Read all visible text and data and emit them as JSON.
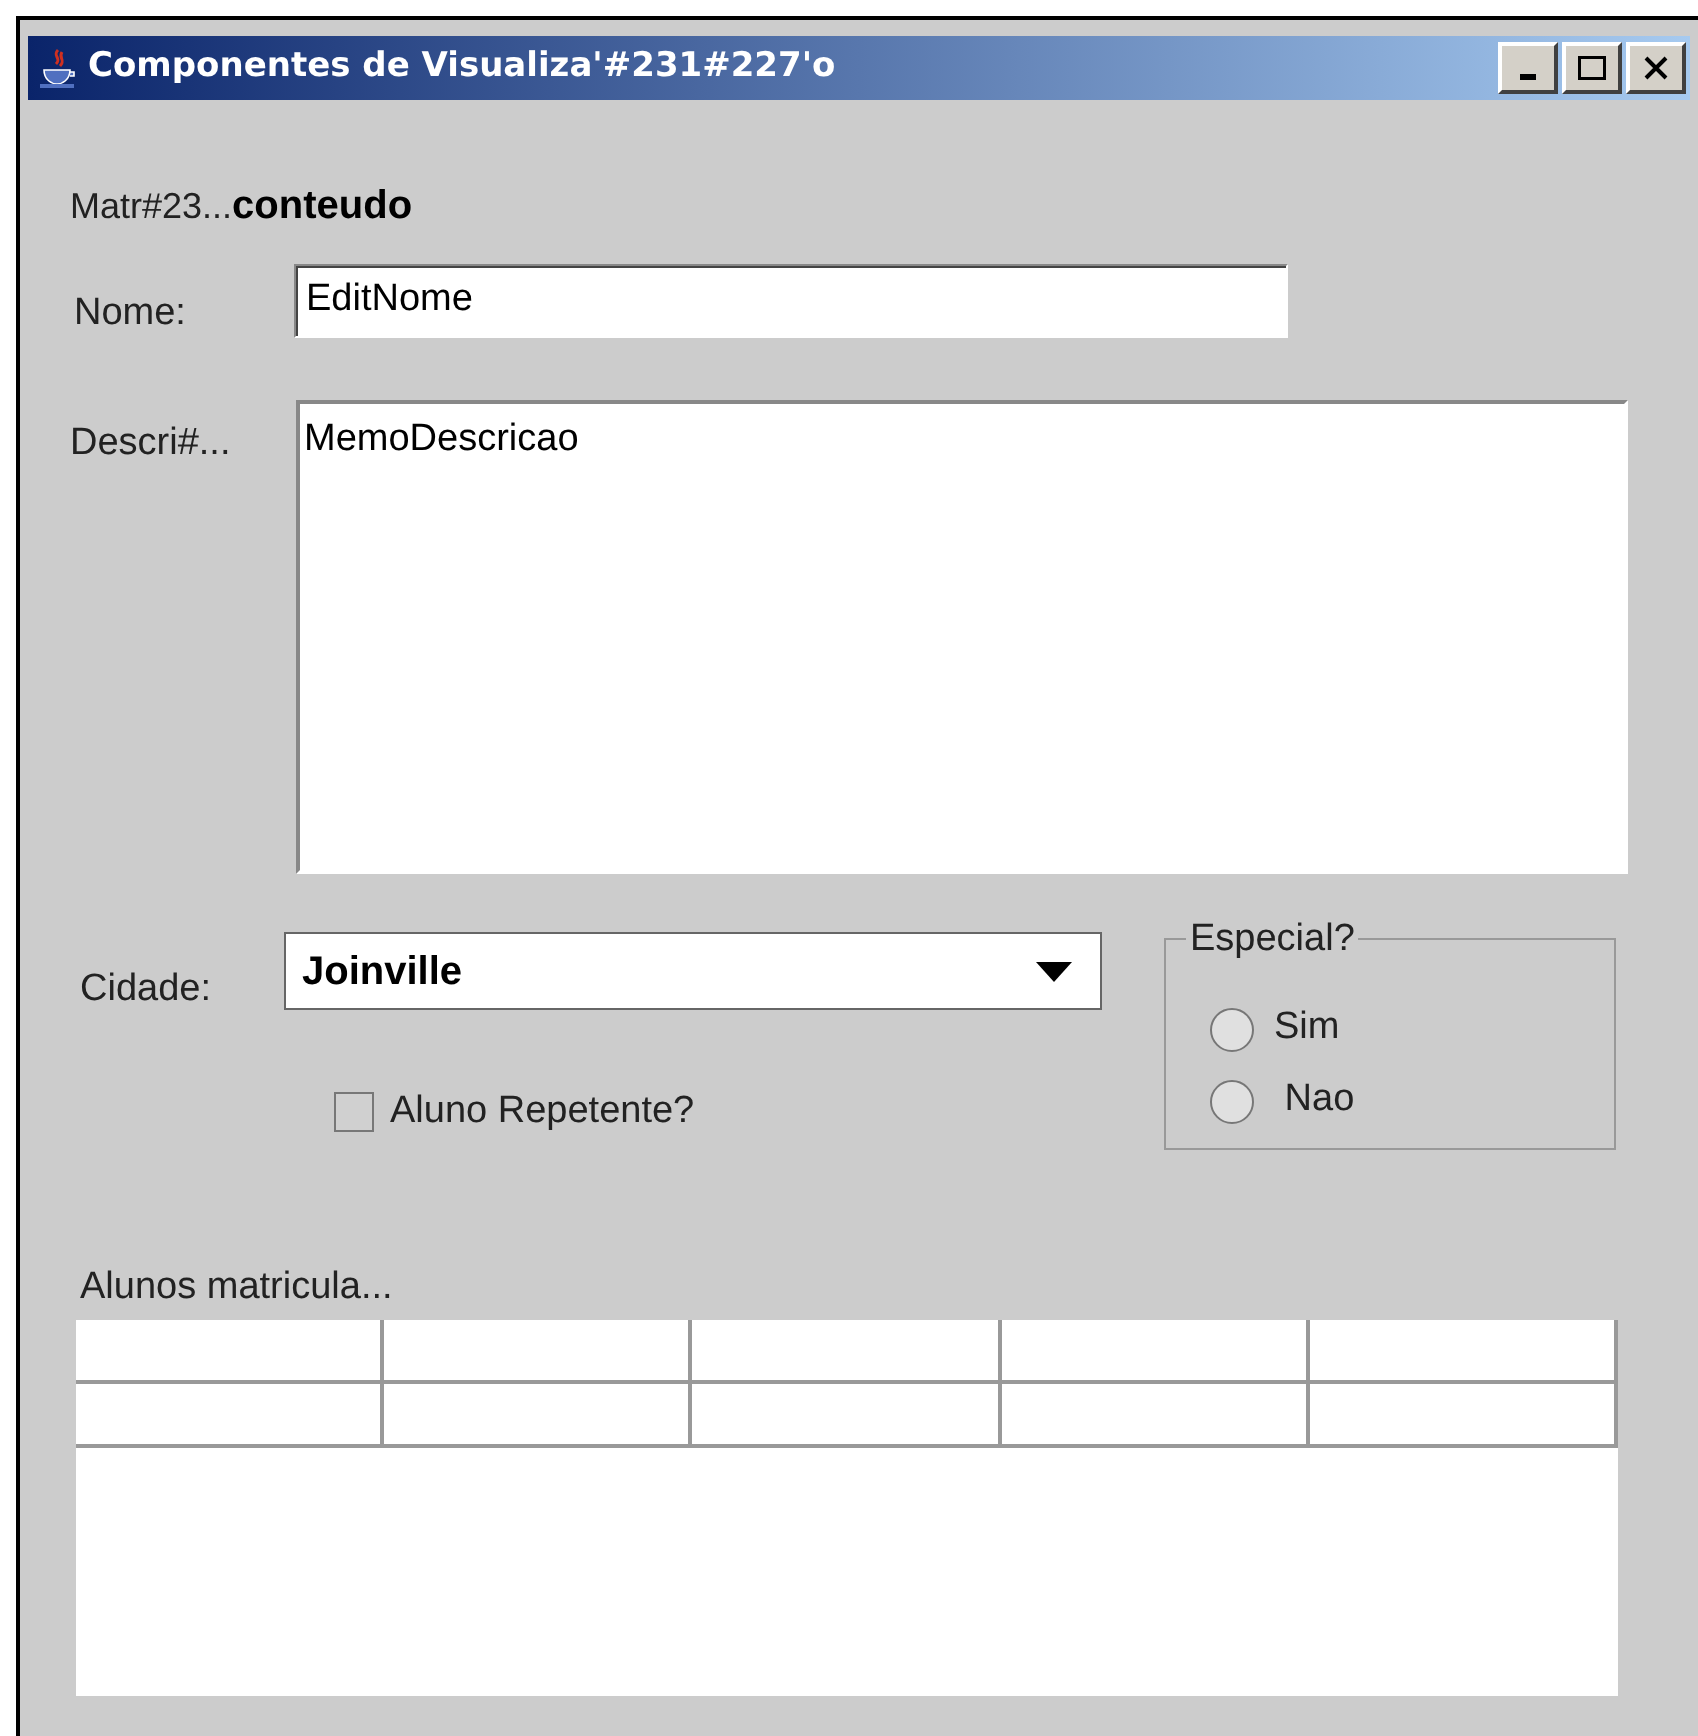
{
  "window": {
    "title": "Componentes de Visualiza'#231#227'o",
    "controls": [
      {
        "kind": "minimize"
      },
      {
        "kind": "maximize"
      },
      {
        "kind": "close"
      }
    ]
  },
  "matricula": {
    "label": "Matr#23...",
    "value": "conteudo"
  },
  "nome": {
    "label": "Nome:",
    "value": "EditNome"
  },
  "descricao": {
    "label": "Descri#...",
    "value": "MemoDescricao"
  },
  "cidade": {
    "label": "Cidade:",
    "value": "Joinville"
  },
  "repetente": {
    "label": "Aluno Repetente?",
    "checked": false
  },
  "especial": {
    "legend": "Especial?",
    "options": [
      {
        "label": "Sim",
        "selected": false
      },
      {
        "label": " Nao",
        "selected": false
      }
    ]
  },
  "alunos": {
    "label": "Alunos matricula...",
    "rows": [
      {
        "cells": [
          {
            "kind": "blank"
          },
          {
            "kind": "blank"
          },
          {
            "kind": "blank"
          },
          {
            "kind": "blank"
          },
          {
            "kind": "blank"
          }
        ]
      },
      {
        "cells": [
          {
            "kind": "blank"
          },
          {
            "kind": "blank"
          },
          {
            "kind": "blank"
          },
          {
            "kind": "blank"
          },
          {
            "kind": "blank"
          }
        ]
      }
    ]
  }
}
